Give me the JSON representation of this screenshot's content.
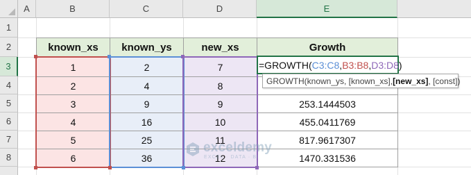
{
  "columns": [
    "A",
    "B",
    "C",
    "D",
    "E"
  ],
  "rows": [
    "1",
    "2",
    "3",
    "4",
    "5",
    "6",
    "7",
    "8"
  ],
  "table": {
    "headers": [
      "known_xs",
      "known_ys",
      "new_xs",
      "Growth"
    ],
    "known_xs": [
      "1",
      "2",
      "3",
      "4",
      "5",
      "6"
    ],
    "known_ys": [
      "2",
      "4",
      "9",
      "16",
      "25",
      "36"
    ],
    "new_xs": [
      "7",
      "8",
      "9",
      "10",
      "11",
      "12"
    ],
    "growth": [
      "",
      "",
      "253.1444503",
      "455.0411769",
      "817.9617307",
      "1470.331536"
    ]
  },
  "formula": {
    "prefix": "=GROWTH(",
    "ref1": "C3:C8",
    "sep1": ",",
    "ref2": "B3:B8",
    "sep2": ",",
    "ref3": "D3:D8",
    "suffix": ")"
  },
  "tooltip": {
    "fn": "GROWTH(",
    "arg1": "known_ys, [known_xs], ",
    "arg_active": "[new_xs]",
    "arg_rest": ", [const])"
  },
  "watermark": {
    "name": "exceldemy",
    "tagline": "EXCEL · DATA · BI"
  },
  "colors": {
    "ref_red": "#c0504d",
    "ref_blue": "#5b8fd6",
    "ref_purple": "#8e67b8",
    "excel_green": "#217346"
  }
}
